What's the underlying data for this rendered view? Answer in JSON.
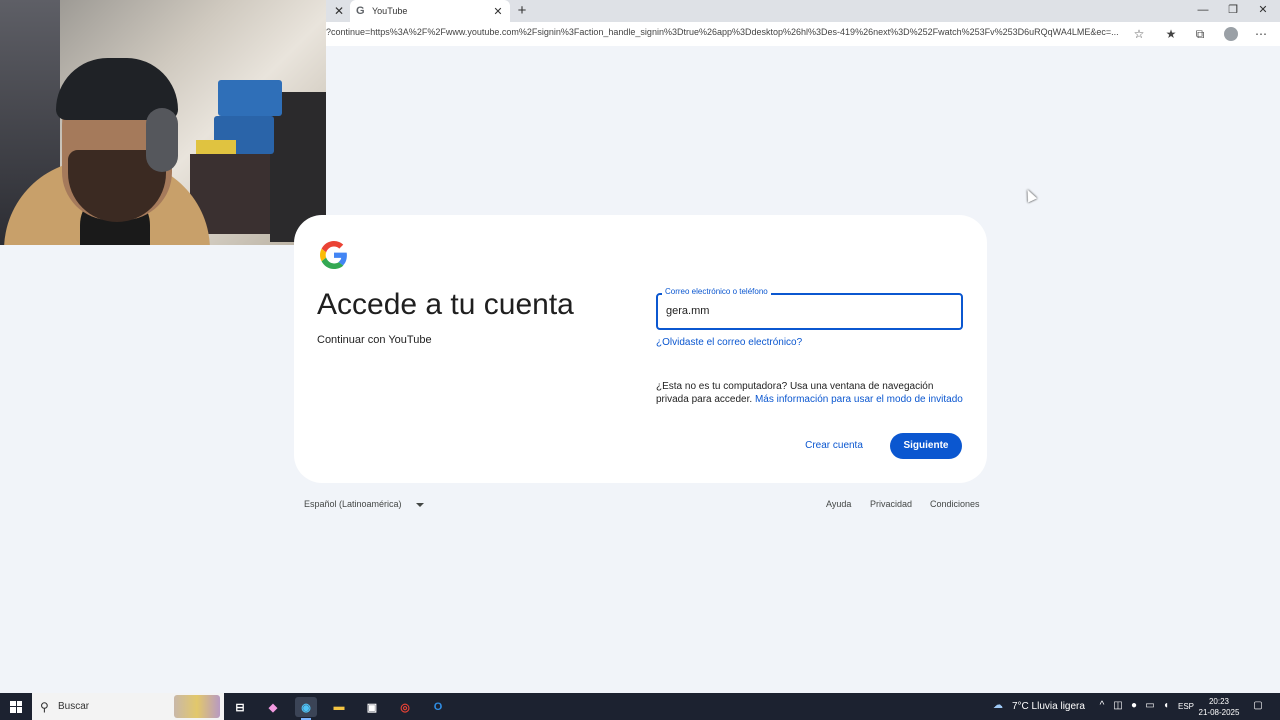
{
  "browser": {
    "tab_title": "YouTube",
    "url": "?continue=https%3A%2F%2Fwww.youtube.com%2Fsignin%3Faction_handle_signin%3Dtrue%26app%3Ddesktop%26hl%3Des-419%26next%3D%252Fwatch%253Fv%253D6uRQqWA4LME&ec=..."
  },
  "signin": {
    "logo_letter": "G",
    "title": "Accede a tu cuenta",
    "subtitle": "Continuar con YouTube",
    "field_label": "Correo electrónico o teléfono",
    "field_value": "gera.mm",
    "forgot_link": "¿Olvidaste el correo electrónico?",
    "guest_text": "¿Esta no es tu computadora? Usa una ventana de navegación privada para acceder.",
    "guest_link": "Más información para usar el modo de invitado",
    "create_account": "Crear cuenta",
    "next_button": "Siguiente"
  },
  "footer": {
    "language": "Español (Latinoamérica)",
    "help": "Ayuda",
    "privacy": "Privacidad",
    "terms": "Condiciones"
  },
  "taskbar": {
    "search_placeholder": "Buscar",
    "weather": "7°C  Lluvia ligera",
    "language": "ESP",
    "time": "20:23",
    "date": "21-08-2025"
  },
  "colors": {
    "accent": "#0b57d0",
    "page_bg": "#f1f4f9",
    "taskbar_bg": "#1c2230"
  }
}
